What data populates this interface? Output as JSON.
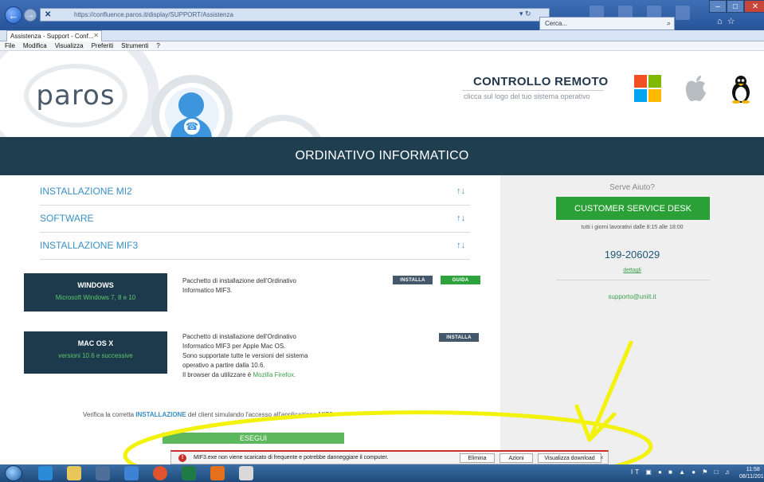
{
  "browser": {
    "url": "https://confluence.paros.it/display/SUPPORT/Assistenza",
    "search_placeholder": "Cerca...",
    "tab_title": "Assistenza - Support - Conf...",
    "menu": [
      "File",
      "Modifica",
      "Visualizza",
      "Preferiti",
      "Strumenti",
      "?"
    ]
  },
  "header": {
    "logo_text": "paros",
    "remote_title": "CONTROLLO REMOTO",
    "remote_subtitle": "clicca sul logo del tuo sistema operativo",
    "os_icons": [
      "windows-logo-icon",
      "apple-logo-icon",
      "linux-tux-icon"
    ],
    "banner": "ORDINATIVO INFORMATICO"
  },
  "accordion": [
    {
      "label": "INSTALLAZIONE MI2",
      "arrow": "↑↓"
    },
    {
      "label": "SOFTWARE",
      "arrow": "↑↓"
    },
    {
      "label": "INSTALLAZIONE MIF3",
      "arrow": "↑↓"
    }
  ],
  "windows_card": {
    "name": "WINDOWS",
    "versions": "Microsoft Windows 7, 8 e 10",
    "desc": "Pacchetto di installazione dell'Ordinativo Informatico MIF3.",
    "install_label": "INSTALLA",
    "guide_label": "GUIDA"
  },
  "mac_card": {
    "name": "MAC OS X",
    "versions": "versioni 10.6 e successive",
    "desc_lines": [
      "Pacchetto di installazione dell'Ordinativo",
      "Informatico MIF3 per Apple Mac OS.",
      "Sono supportate tutte le versioni del sistema",
      "operativo a partire dalla 10.6."
    ],
    "browser_prefix": "Il browser da utilizzare è",
    "browser_link": "Mozilla Firefox.",
    "install_label": "INSTALLA"
  },
  "verify": {
    "prefix": "Verifica la corretta",
    "bold": "INSTALLAZIONE",
    "suffix": "del client simulando l'accesso all'applicazione MIF3"
  },
  "run_label": "ESEGUI",
  "help": {
    "title": "Serve Aiuto?",
    "csd_label": "CUSTOMER SERVICE DESK",
    "hours": "tutti i giorni lavorativi dalle 8:15 alle 18:00",
    "phone": "199-206029",
    "details": "dettagli",
    "email": "supporto@uniit.it"
  },
  "download_bar": {
    "message": "MIF3.exe non viene scaricato di frequente e potrebbe danneggiare il computer.",
    "delete_label": "Elimina",
    "actions_label": "Azioni",
    "view_label": "Visualizza download",
    "close_label": "×"
  },
  "taskbar": {
    "language": "IT",
    "time": "11:58",
    "date": "08/11/2016"
  },
  "colors": {
    "banner_bg": "#1f3f51",
    "accent_blue": "#3a8fc4",
    "accent_green": "#2aa036",
    "annotation_yellow": "#f2f20a"
  }
}
